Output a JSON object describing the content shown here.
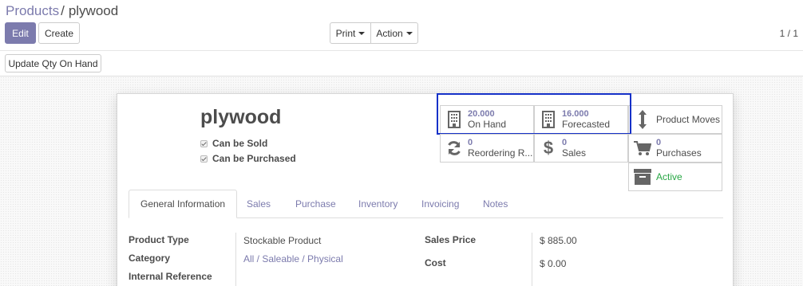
{
  "breadcrumb": {
    "parent": "Products",
    "separator": "/",
    "current": "plywood"
  },
  "buttons": {
    "edit": "Edit",
    "create": "Create",
    "print": "Print",
    "action": "Action",
    "update_qty": "Update Qty On Hand"
  },
  "pager": "1 / 1",
  "product": {
    "name": "plywood",
    "can_be_sold": "Can be Sold",
    "can_be_purchased": "Can be Purchased"
  },
  "smart_buttons": {
    "on_hand": {
      "value": "20.000",
      "label": "On Hand",
      "icon": "building-icon"
    },
    "forecasted": {
      "value": "16.000",
      "label": "Forecasted",
      "icon": "building-icon"
    },
    "product_moves": {
      "label": "Product Moves",
      "icon": "arrows-vertical-icon"
    },
    "reordering": {
      "value": "0",
      "label": "Reordering R...",
      "icon": "refresh-icon"
    },
    "sales": {
      "value": "0",
      "label": "Sales",
      "icon": "dollar-icon"
    },
    "purchases": {
      "value": "0",
      "label": "Purchases",
      "icon": "cart-icon"
    },
    "active": {
      "label": "Active",
      "icon": "archive-icon"
    }
  },
  "tabs": [
    "General Information",
    "Sales",
    "Purchase",
    "Inventory",
    "Invoicing",
    "Notes"
  ],
  "fields": {
    "product_type": {
      "label": "Product Type",
      "value": "Stockable Product"
    },
    "category": {
      "label": "Category",
      "value": "All / Saleable / Physical"
    },
    "internal_reference": {
      "label": "Internal Reference"
    },
    "sales_price": {
      "label": "Sales Price",
      "value": "$ 885.00"
    },
    "cost": {
      "label": "Cost",
      "value": "$ 0.00"
    }
  },
  "colors": {
    "accent": "#7c7bad",
    "highlight": "#1531c8",
    "active_green": "#28a745"
  }
}
